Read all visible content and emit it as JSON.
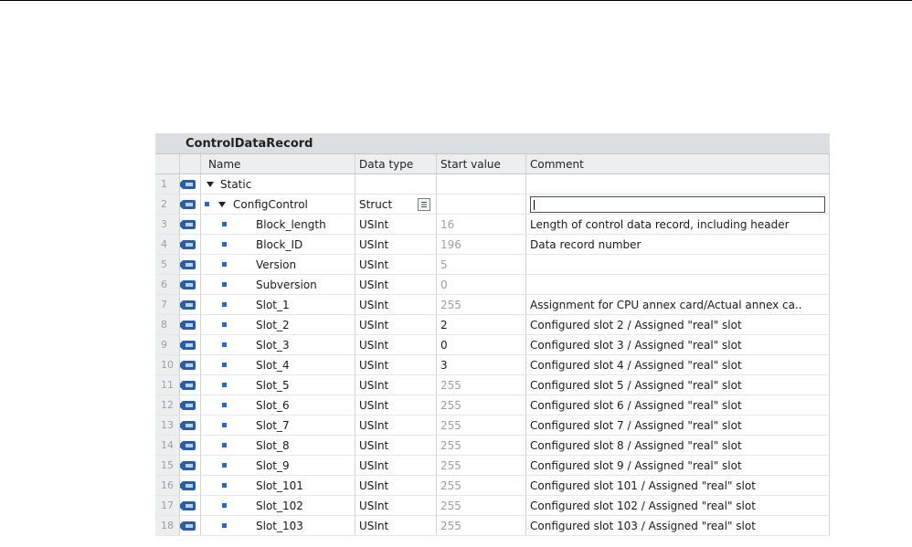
{
  "block_title": "ControlDataRecord",
  "columns": {
    "name": "Name",
    "data_type": "Data type",
    "start_value": "Start value",
    "comment": "Comment"
  },
  "rows": [
    {
      "num": "1",
      "name": "Static",
      "type": "",
      "start": "",
      "comment": ""
    },
    {
      "num": "2",
      "name": "ConfigControl",
      "type": "Struct",
      "start": "",
      "comment": ""
    },
    {
      "num": "3",
      "name": "Block_length",
      "type": "USInt",
      "start": "16",
      "comment": "Length of control data record, including header"
    },
    {
      "num": "4",
      "name": "Block_ID",
      "type": "USInt",
      "start": "196",
      "comment": "Data record number"
    },
    {
      "num": "5",
      "name": "Version",
      "type": "USInt",
      "start": "5",
      "comment": ""
    },
    {
      "num": "6",
      "name": "Subversion",
      "type": "USInt",
      "start": "0",
      "comment": ""
    },
    {
      "num": "7",
      "name": "Slot_1",
      "type": "USInt",
      "start": "255",
      "comment": "Assignment for CPU annex card/Actual annex ca.."
    },
    {
      "num": "8",
      "name": "Slot_2",
      "type": "USInt",
      "start": "2",
      "comment": "Configured slot 2 / Assigned \"real\" slot"
    },
    {
      "num": "9",
      "name": "Slot_3",
      "type": "USInt",
      "start": "0",
      "comment": "Configured slot 3 / Assigned \"real\" slot"
    },
    {
      "num": "10",
      "name": "Slot_4",
      "type": "USInt",
      "start": "3",
      "comment": "Configured slot 4 / Assigned \"real\" slot"
    },
    {
      "num": "11",
      "name": "Slot_5",
      "type": "USInt",
      "start": "255",
      "comment": "Configured slot 5 / Assigned \"real\" slot"
    },
    {
      "num": "12",
      "name": "Slot_6",
      "type": "USInt",
      "start": "255",
      "comment": "Configured slot 6 / Assigned \"real\" slot"
    },
    {
      "num": "13",
      "name": "Slot_7",
      "type": "USInt",
      "start": "255",
      "comment": "Configured slot 7 / Assigned \"real\" slot"
    },
    {
      "num": "14",
      "name": "Slot_8",
      "type": "USInt",
      "start": "255",
      "comment": "Configured slot 8 / Assigned \"real\" slot"
    },
    {
      "num": "15",
      "name": "Slot_9",
      "type": "USInt",
      "start": "255",
      "comment": "Configured slot 9 / Assigned \"real\" slot"
    },
    {
      "num": "16",
      "name": "Slot_101",
      "type": "USInt",
      "start": "255",
      "comment": "Configured slot 101 / Assigned \"real\" slot"
    },
    {
      "num": "17",
      "name": "Slot_102",
      "type": "USInt",
      "start": "255",
      "comment": "Configured slot 102 / Assigned \"real\" slot"
    },
    {
      "num": "18",
      "name": "Slot_103",
      "type": "USInt",
      "start": "255",
      "comment": "Configured slot 103 / Assigned \"real\" slot"
    }
  ]
}
